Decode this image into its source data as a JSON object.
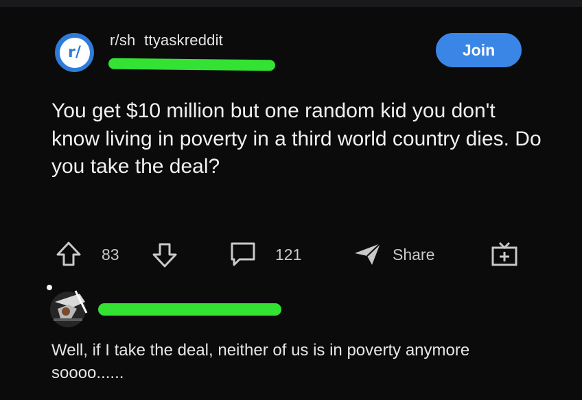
{
  "post": {
    "subreddit": "r/sh  ttyaskreddit",
    "subreddit_icon_text": "r/",
    "join_label": "Join",
    "title": "You get $10 million but one random kid you don't know living in poverty in a third world country dies. Do you take the deal?",
    "score": "83",
    "comment_count": "121",
    "share_label": "Share"
  },
  "comment": {
    "text": "Well, if I take the deal, neither of us is in poverty anymore soooo......"
  },
  "colors": {
    "background": "#0b0b0c",
    "accent_blue": "#3a86e6",
    "redaction_green": "#33e233"
  },
  "icons": {
    "upvote": "arrow-up-outline-icon",
    "downvote": "arrow-down-outline-icon",
    "comment": "speech-bubble-icon",
    "share": "paper-plane-icon",
    "award": "gift-box-icon"
  }
}
